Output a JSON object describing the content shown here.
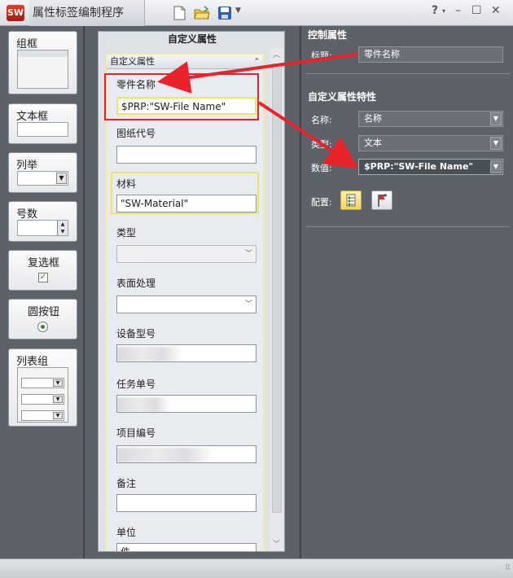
{
  "window": {
    "logo_text": "SW",
    "title": "属性标签编制程序",
    "controls": [
      "?",
      "▾",
      "–",
      "☐",
      "✕"
    ]
  },
  "toolbox": {
    "items": [
      {
        "label": "组框"
      },
      {
        "label": "文本框"
      },
      {
        "label": "列举"
      },
      {
        "label": "号数"
      },
      {
        "label": "复选框"
      },
      {
        "label": "圆按钮"
      },
      {
        "label": "列表组"
      }
    ]
  },
  "form": {
    "title": "自定义属性",
    "group_title": "自定义属性",
    "fields": [
      {
        "label": "零件名称",
        "value": "$PRP:\"SW-File Name\""
      },
      {
        "label": "图纸代号",
        "value": ""
      },
      {
        "label": "材料",
        "value": "\"SW-Material\""
      },
      {
        "label": "类型",
        "value": ""
      },
      {
        "label": "表面处理",
        "value": ""
      },
      {
        "label": "设备型号",
        "value": ""
      },
      {
        "label": "任务单号",
        "value": ""
      },
      {
        "label": "项目编号",
        "value": ""
      },
      {
        "label": "备注",
        "value": ""
      },
      {
        "label": "单位",
        "value": "件"
      }
    ]
  },
  "properties": {
    "control_header": "控制属性",
    "caption_label": "标题:",
    "caption_value": "零件名称",
    "custom_header": "自定义属性特性",
    "name_label": "名称:",
    "name_value": "名称",
    "type_label": "类型:",
    "type_value": "文本",
    "value_label": "数值:",
    "value_value": "$PRP:\"SW-File Name\"",
    "config_label": "配置:"
  },
  "colors": {
    "highlight_border": "#e8232a",
    "annotation_arrow": "#e8232a",
    "group_border": "#f0eaa0"
  }
}
